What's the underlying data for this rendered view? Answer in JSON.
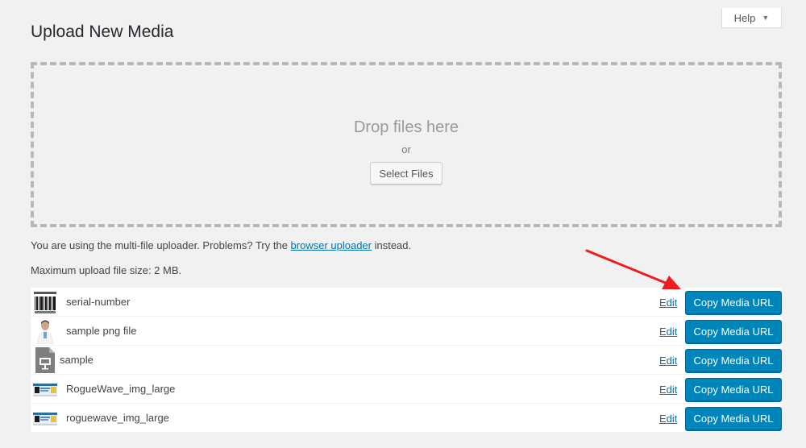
{
  "header": {
    "title": "Upload New Media",
    "help_label": "Help"
  },
  "uploader": {
    "drop_text": "Drop files here",
    "or_text": "or",
    "select_label": "Select Files"
  },
  "notice": {
    "text_before": "You are using the multi-file uploader. Problems? Try the ",
    "link_text": "browser uploader",
    "text_after": " instead.",
    "max_size": "Maximum upload file size: 2 MB."
  },
  "media_items": [
    {
      "filename": "serial-number",
      "thumb": "barcode-thumbnail",
      "edit_label": "Edit",
      "copy_label": "Copy Media URL"
    },
    {
      "filename": "sample png file",
      "thumb": "person-thumbnail",
      "edit_label": "Edit",
      "copy_label": "Copy Media URL"
    },
    {
      "filename": "sample",
      "thumb": "document-icon",
      "edit_label": "Edit",
      "copy_label": "Copy Media URL"
    },
    {
      "filename": "RogueWave_img_large",
      "thumb": "screenshot-thumbnail",
      "edit_label": "Edit",
      "copy_label": "Copy Media URL"
    },
    {
      "filename": "roguewave_img_large",
      "thumb": "screenshot-thumbnail",
      "edit_label": "Edit",
      "copy_label": "Copy Media URL"
    }
  ],
  "colors": {
    "accent": "#0085ba",
    "link": "#0073aa",
    "annotation_arrow": "#ee1c1c"
  }
}
